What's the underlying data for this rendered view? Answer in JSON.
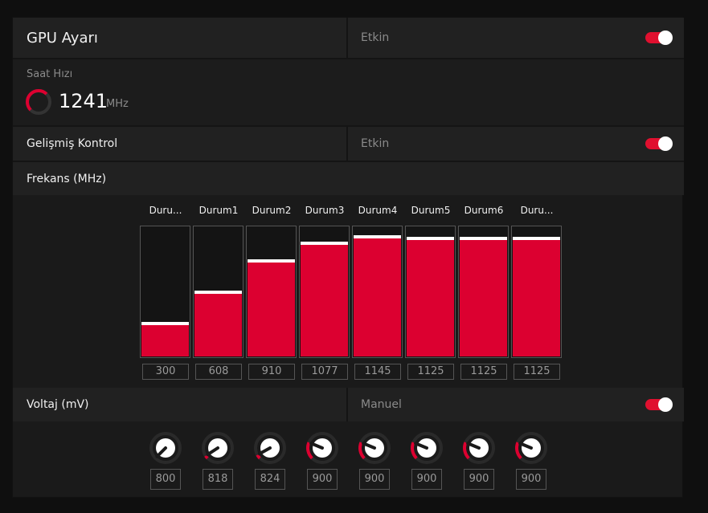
{
  "gpu": {
    "title": "GPU Ayarı",
    "status": "Etkin",
    "enabled": true
  },
  "clock": {
    "label": "Saat Hızı",
    "value": "1241",
    "unit": "MHz"
  },
  "advanced": {
    "title": "Gelişmiş Kontrol",
    "status": "Etkin",
    "enabled": true
  },
  "frequency": {
    "title": "Frekans (MHz)",
    "max": 1250,
    "states": [
      {
        "label": "Duru...",
        "value": "300",
        "level": 300
      },
      {
        "label": "Durum1",
        "value": "608",
        "level": 608
      },
      {
        "label": "Durum2",
        "value": "910",
        "level": 910
      },
      {
        "label": "Durum3",
        "value": "1077",
        "level": 1077
      },
      {
        "label": "Durum4",
        "value": "1145",
        "level": 1145
      },
      {
        "label": "Durum5",
        "value": "1125",
        "level": 1125
      },
      {
        "label": "Durum6",
        "value": "1125",
        "level": 1125
      },
      {
        "label": "Duru...",
        "value": "1125",
        "level": 1125
      }
    ]
  },
  "voltage": {
    "title": "Voltaj (mV)",
    "mode": "Manuel",
    "enabled": true,
    "knobs": [
      {
        "value": "800"
      },
      {
        "value": "818"
      },
      {
        "value": "824"
      },
      {
        "value": "900"
      },
      {
        "value": "900"
      },
      {
        "value": "900"
      },
      {
        "value": "900"
      },
      {
        "value": "900"
      }
    ]
  },
  "colors": {
    "accent": "#dc0030",
    "panel": "#1a1a1a",
    "row": "#212121"
  }
}
